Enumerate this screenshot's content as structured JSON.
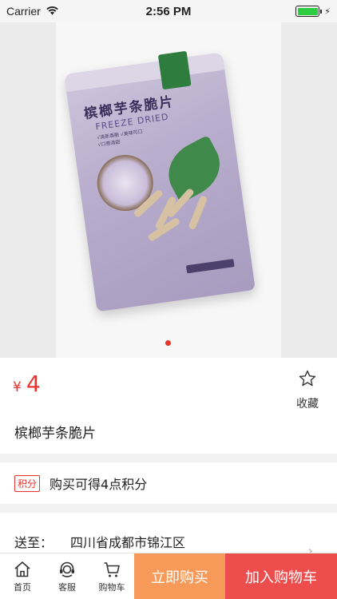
{
  "status_bar": {
    "carrier": "Carrier",
    "time": "2:56 PM"
  },
  "gallery": {
    "pack_title": "槟榔芋条脆片",
    "pack_subtitle": "FREEZE DRIED",
    "pack_lines": [
      "√清新香脆 √美味可口",
      "√口感清甜"
    ],
    "page_count": 1,
    "active_index": 0
  },
  "product": {
    "currency": "¥",
    "price": "4",
    "name": "槟榔芋条脆片",
    "favorite_label": "收藏"
  },
  "points": {
    "tag": "积分",
    "text": "购买可得4点积分"
  },
  "shipping": {
    "label": "送至：",
    "value": "四川省成都市锦江区"
  },
  "bottom_bar": {
    "home": "首页",
    "service": "客服",
    "cart": "购物车",
    "buy_now": "立即购买",
    "add_to_cart": "加入购物车"
  },
  "colors": {
    "accent": "#e7322e",
    "buy_now": "#f79a59",
    "add_to_cart": "#ee4d4d"
  }
}
